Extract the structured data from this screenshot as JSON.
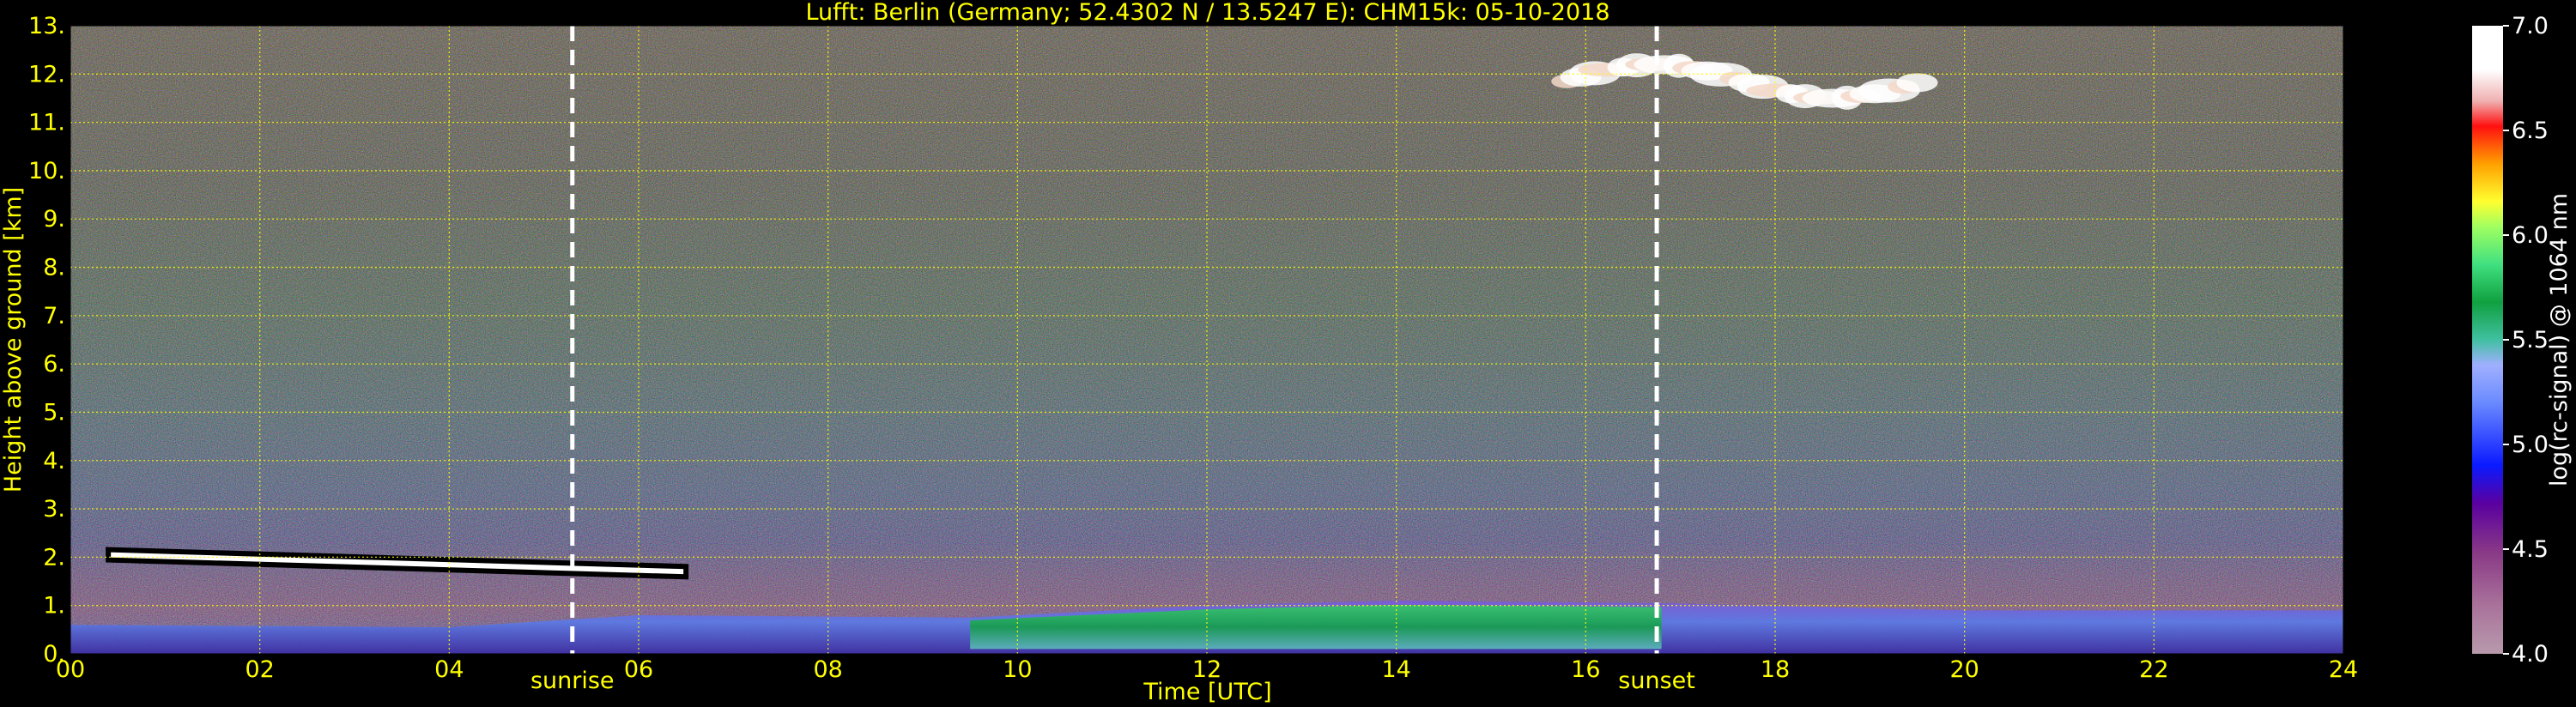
{
  "chart_data": {
    "type": "heatmap",
    "title": "Lufft: Berlin (Germany; 52.4302 N / 13.5247 E):    CHM15k: 05-10-2018",
    "xlabel": "Time [UTC]",
    "ylabel": "Height above ground [km]",
    "xlim": [
      0,
      24
    ],
    "ylim": [
      0,
      13
    ],
    "x_ticks": [
      "00",
      "02",
      "04",
      "06",
      "08",
      "10",
      "12",
      "14",
      "16",
      "18",
      "20",
      "22",
      "24"
    ],
    "y_ticks": [
      "0.",
      "1.",
      "2.",
      "3.",
      "4.",
      "5.",
      "6.",
      "7.",
      "8.",
      "9.",
      "10.",
      "11.",
      "12.",
      "13."
    ],
    "grid": true,
    "colorbar": {
      "label": "log(rc-signal) @ 1064 nm",
      "range": [
        4.0,
        7.0
      ],
      "ticks": [
        "4.0",
        "4.5",
        "5.0",
        "5.5",
        "6.0",
        "6.5",
        "7.0"
      ]
    },
    "annotations": [
      {
        "text": "sunrise",
        "x": 5.3
      },
      {
        "text": "sunset",
        "x": 16.75
      }
    ],
    "features": {
      "residual_layer": {
        "x": [
          0.4,
          6.5
        ],
        "height_km": [
          2.05,
          1.7
        ]
      },
      "cirrus_cloud": {
        "x": [
          15.8,
          19.5
        ],
        "height_km": [
          11.5,
          12.2
        ]
      },
      "boundary_layer_top_km": [
        {
          "x": 0,
          "y": 0.6
        },
        {
          "x": 4,
          "y": 0.55
        },
        {
          "x": 6,
          "y": 0.8
        },
        {
          "x": 9.5,
          "y": 0.75
        },
        {
          "x": 12,
          "y": 1.0
        },
        {
          "x": 14,
          "y": 1.1
        },
        {
          "x": 16.8,
          "y": 1.05
        },
        {
          "x": 20,
          "y": 0.9
        },
        {
          "x": 24,
          "y": 0.9
        }
      ]
    },
    "colors": {
      "text": "#ffff00",
      "grid": "#ffff00",
      "markers": "#ffffff",
      "background": "#000000"
    }
  }
}
